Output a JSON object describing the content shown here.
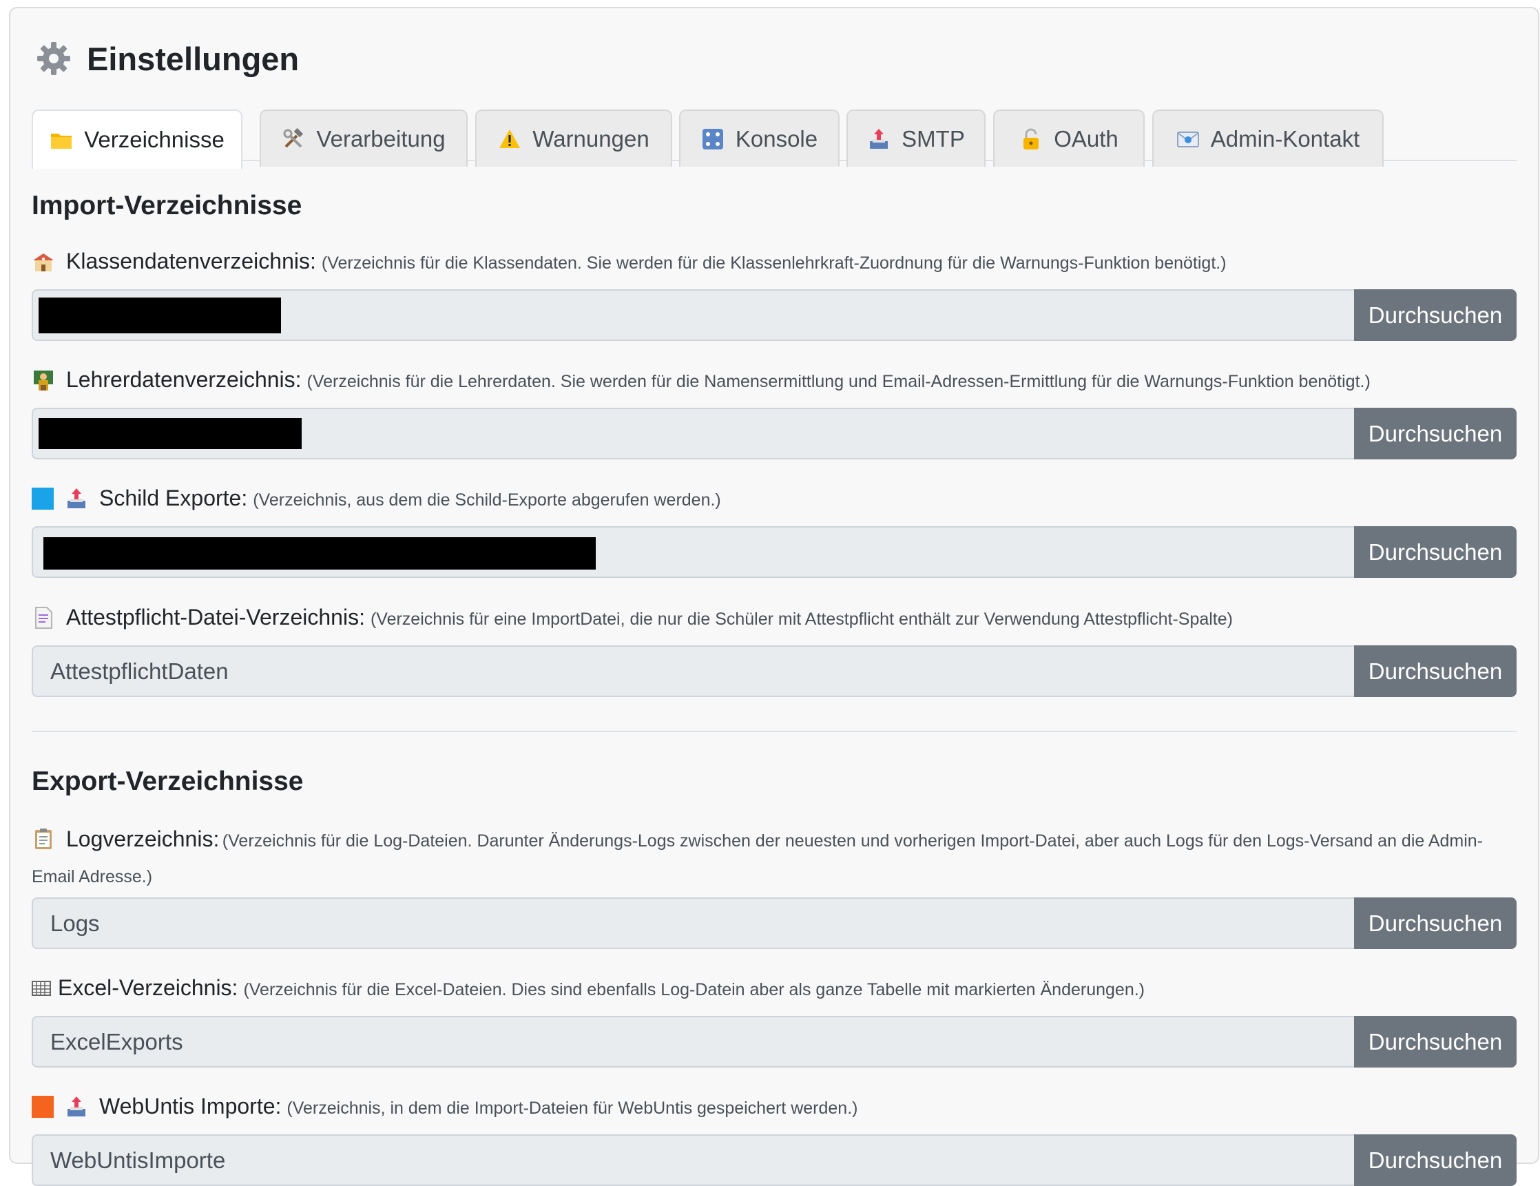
{
  "header": {
    "title": "Einstellungen",
    "icon": "gear-icon"
  },
  "tabs": [
    {
      "label": "Verzeichnisse",
      "icon": "folder-icon",
      "active": true
    },
    {
      "label": "Verarbeitung",
      "icon": "hammer-wrench-icon"
    },
    {
      "label": "Warnungen",
      "icon": "warning-icon"
    },
    {
      "label": "Konsole",
      "icon": "console-icon"
    },
    {
      "label": "SMTP",
      "icon": "outbox-icon"
    },
    {
      "label": "OAuth",
      "icon": "lock-icon"
    },
    {
      "label": "Admin-Kontakt",
      "icon": "email-icon"
    }
  ],
  "import_section": {
    "title": "Import-Verzeichnisse",
    "fields": [
      {
        "label": "Klassendatenverzeichnis:",
        "desc": "(Verzeichnis für die Klassendaten. Sie werden für die Klassenlehrkraft-Zuordnung für die Warnungs-Funktion benötigt.)",
        "value": "",
        "button": "Durchsuchen",
        "icon": "school-icon"
      },
      {
        "label": "Lehrerdatenverzeichnis:",
        "desc": "(Verzeichnis für die Lehrerdaten. Sie werden für die Namensermittlung und Email-Adressen-Ermittlung für die Warnungs-Funktion benötigt.)",
        "value": "",
        "button": "Durchsuchen",
        "icon": "teacher-icon"
      },
      {
        "label": "Schild Exporte:",
        "desc": "(Verzeichnis, aus dem die Schild-Exporte abgerufen werden.)",
        "value": "",
        "button": "Durchsuchen",
        "icon": "outbox-icon"
      },
      {
        "label": "Attestpflicht-Datei-Verzeichnis:",
        "desc": "(Verzeichnis für eine ImportDatei, die nur die Schüler mit Attestpflicht enthält zur Verwendung Attestpflicht-Spalte)",
        "value": "AttestpflichtDaten",
        "button": "Durchsuchen",
        "icon": "document-icon"
      }
    ]
  },
  "export_section": {
    "title": "Export-Verzeichnisse",
    "fields": [
      {
        "label": "Logverzeichnis:",
        "desc": "(Verzeichnis für die Log-Dateien. Darunter Änderungs-Logs zwischen der neuesten und vorherigen Import-Datei, aber auch Logs für den Logs-Versand an die Admin-Email Adresse.)",
        "value": "Logs",
        "button": "Durchsuchen",
        "icon": "clipboard-icon"
      },
      {
        "label": "Excel-Verzeichnis:",
        "desc": "(Verzeichnis für die Excel-Dateien. Dies sind ebenfalls Log-Datein aber als ganze Tabelle mit markierten Änderungen.)",
        "value": "ExcelExports",
        "button": "Durchsuchen",
        "icon": "grid-icon"
      },
      {
        "label": "WebUntis Importe:",
        "desc": "(Verzeichnis, in dem die Import-Dateien für WebUntis gespeichert werden.)",
        "value": "WebUntisImporte",
        "button": "Durchsuchen",
        "icon": "outbox-icon"
      }
    ]
  },
  "colors": {
    "button": "#6c757d",
    "input_bg": "#e9ecef",
    "blue_square": "#1aa3e8",
    "orange_square": "#f5641e"
  }
}
